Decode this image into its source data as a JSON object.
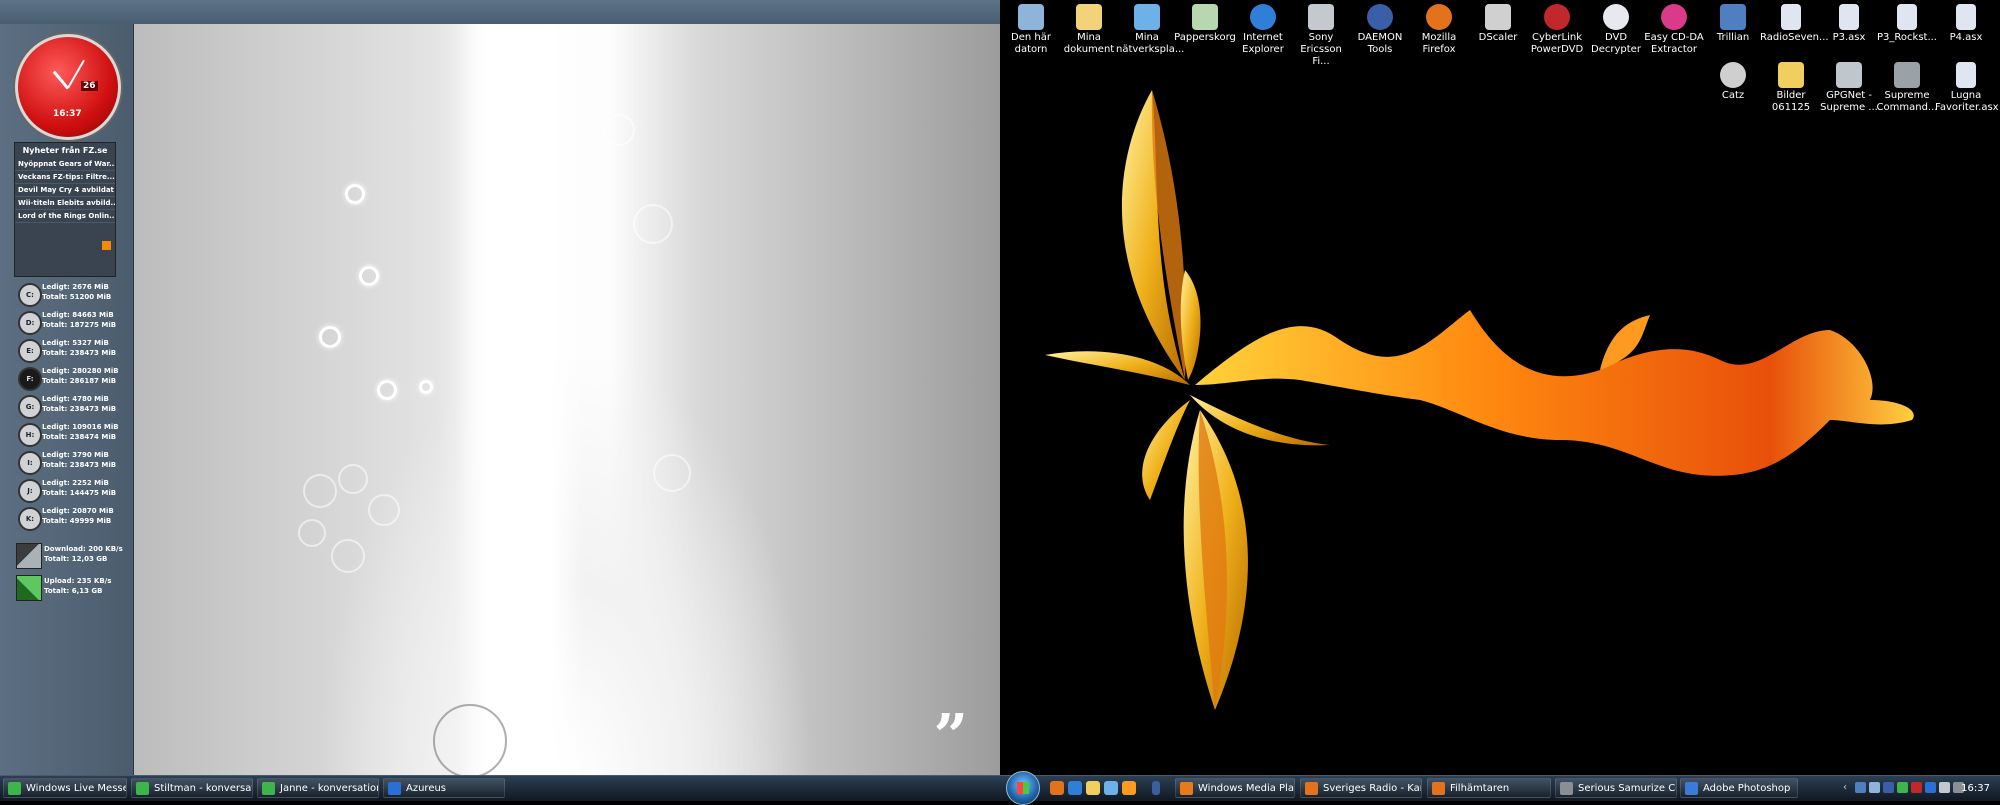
{
  "gadgets": {
    "clock": {
      "date": "26",
      "time": "16:37"
    },
    "news": {
      "title": "Nyheter från FZ.se",
      "items": [
        "Nyöppnat Gears of War...",
        "Veckans FZ-tips: Filtre...",
        "Devil May Cry 4 avbildat",
        "Wii-titeln Elebits avbild...",
        "Lord of the Rings Onlin..."
      ]
    },
    "drives": [
      {
        "letter": "C:",
        "free": "Ledigt: 2676 MiB",
        "total": "Totalt: 51200 MiB"
      },
      {
        "letter": "D:",
        "free": "Ledigt: 84663 MiB",
        "total": "Totalt: 187275 MiB"
      },
      {
        "letter": "E:",
        "free": "Ledigt: 5327 MiB",
        "total": "Totalt: 238473 MiB"
      },
      {
        "letter": "F:",
        "free": "Ledigt: 280280 MiB",
        "total": "Totalt: 286187 MiB"
      },
      {
        "letter": "G:",
        "free": "Ledigt: 4780 MiB",
        "total": "Totalt: 238473 MiB"
      },
      {
        "letter": "H:",
        "free": "Ledigt: 109016 MiB",
        "total": "Totalt: 238474 MiB"
      },
      {
        "letter": "I:",
        "free": "Ledigt: 3790 MiB",
        "total": "Totalt: 238473 MiB"
      },
      {
        "letter": "J:",
        "free": "Ledigt: 2252 MiB",
        "total": "Totalt: 144475 MiB"
      },
      {
        "letter": "K:",
        "free": "Ledigt: 20870 MiB",
        "total": "Totalt: 49999 MiB"
      }
    ],
    "network": {
      "download": {
        "rate": "Download: 200 KB/s",
        "total": "Totalt: 12,03 GB"
      },
      "upload": {
        "rate": "Upload: 235 KB/s",
        "total": "Totalt: 6,13 GB"
      }
    }
  },
  "desktop_icons": [
    {
      "label": "Den här datorn",
      "icon": "computer-icon",
      "color": "#8fb4d9"
    },
    {
      "label": "Mina dokument",
      "icon": "documents-folder-icon",
      "color": "#f3d37a"
    },
    {
      "label": "Mina nätverkspla...",
      "icon": "network-places-icon",
      "color": "#6db1e8"
    },
    {
      "label": "Papperskorg",
      "icon": "recycle-bin-icon",
      "color": "#b7d7b0"
    },
    {
      "label": "Internet Explorer",
      "icon": "internet-explorer-icon",
      "color": "#2f7fd8"
    },
    {
      "label": "Sony Ericsson Fi...",
      "icon": "sony-ericsson-icon",
      "color": "#c4c9cf"
    },
    {
      "label": "DAEMON Tools",
      "icon": "daemon-tools-icon",
      "color": "#3a5fa8"
    },
    {
      "label": "Mozilla Firefox",
      "icon": "firefox-icon",
      "color": "#e2731c"
    },
    {
      "label": "DScaler",
      "icon": "dscaler-icon",
      "color": "#d0d0d0"
    },
    {
      "label": "CyberLink PowerDVD",
      "icon": "powerdvd-icon",
      "color": "#c0282b"
    },
    {
      "label": "DVD Decrypter",
      "icon": "dvd-decrypter-icon",
      "color": "#e8e8ef"
    },
    {
      "label": "Easy CD-DA Extractor",
      "icon": "cd-extractor-icon",
      "color": "#d93a8a"
    },
    {
      "label": "Trillian",
      "icon": "trillian-icon",
      "color": "#4f7fc0"
    },
    {
      "label": "RadioSeven...",
      "icon": "asx-file-icon",
      "color": "#dfe6f2"
    },
    {
      "label": "P3.asx",
      "icon": "asx-file-icon",
      "color": "#dfe6f2"
    },
    {
      "label": "P3_Rockst...",
      "icon": "asx-file-icon",
      "color": "#dfe6f2"
    },
    {
      "label": "P4.asx",
      "icon": "asx-file-icon",
      "color": "#dfe6f2"
    },
    {
      "label": "Catz",
      "icon": "catz-icon",
      "color": "#cfcfcf"
    },
    {
      "label": "Bilder 061125",
      "icon": "folder-icon",
      "color": "#f0cf5e"
    },
    {
      "label": "GPGNet - Supreme ...",
      "icon": "gpgnet-icon",
      "color": "#bfc6cc"
    },
    {
      "label": "Supreme Command...",
      "icon": "supreme-commander-icon",
      "color": "#9aa2a8"
    },
    {
      "label": "Lugna Favoriter.asx",
      "icon": "asx-file-icon",
      "color": "#dfe6f2"
    }
  ],
  "taskbar": {
    "left_buttons": [
      {
        "label": "Windows Live Messe...",
        "icon": "messenger-icon",
        "color": "#3db54a"
      },
      {
        "label": "Stiltman - konversati...",
        "icon": "messenger-icon",
        "color": "#3db54a"
      },
      {
        "label": "Janne - konversation",
        "icon": "messenger-icon",
        "color": "#3db54a"
      },
      {
        "label": "Azureus",
        "icon": "azureus-icon",
        "color": "#2a6fd6"
      }
    ],
    "right_buttons": [
      {
        "label": "Windows Media Pla...",
        "icon": "media-player-icon",
        "color": "#e87a1a"
      },
      {
        "label": "Sveriges Radio - Kan...",
        "icon": "firefox-icon",
        "color": "#e2731c"
      },
      {
        "label": "Filhämtaren",
        "icon": "firefox-icon",
        "color": "#e2731c"
      },
      {
        "label": "Serious Samurize Co...",
        "icon": "samurize-icon",
        "color": "#8a8f96"
      },
      {
        "label": "Adobe Photoshop",
        "icon": "photoshop-icon",
        "color": "#3b7bd6"
      }
    ],
    "clock": "16:37"
  },
  "wallpaper_quote_mark": "”"
}
